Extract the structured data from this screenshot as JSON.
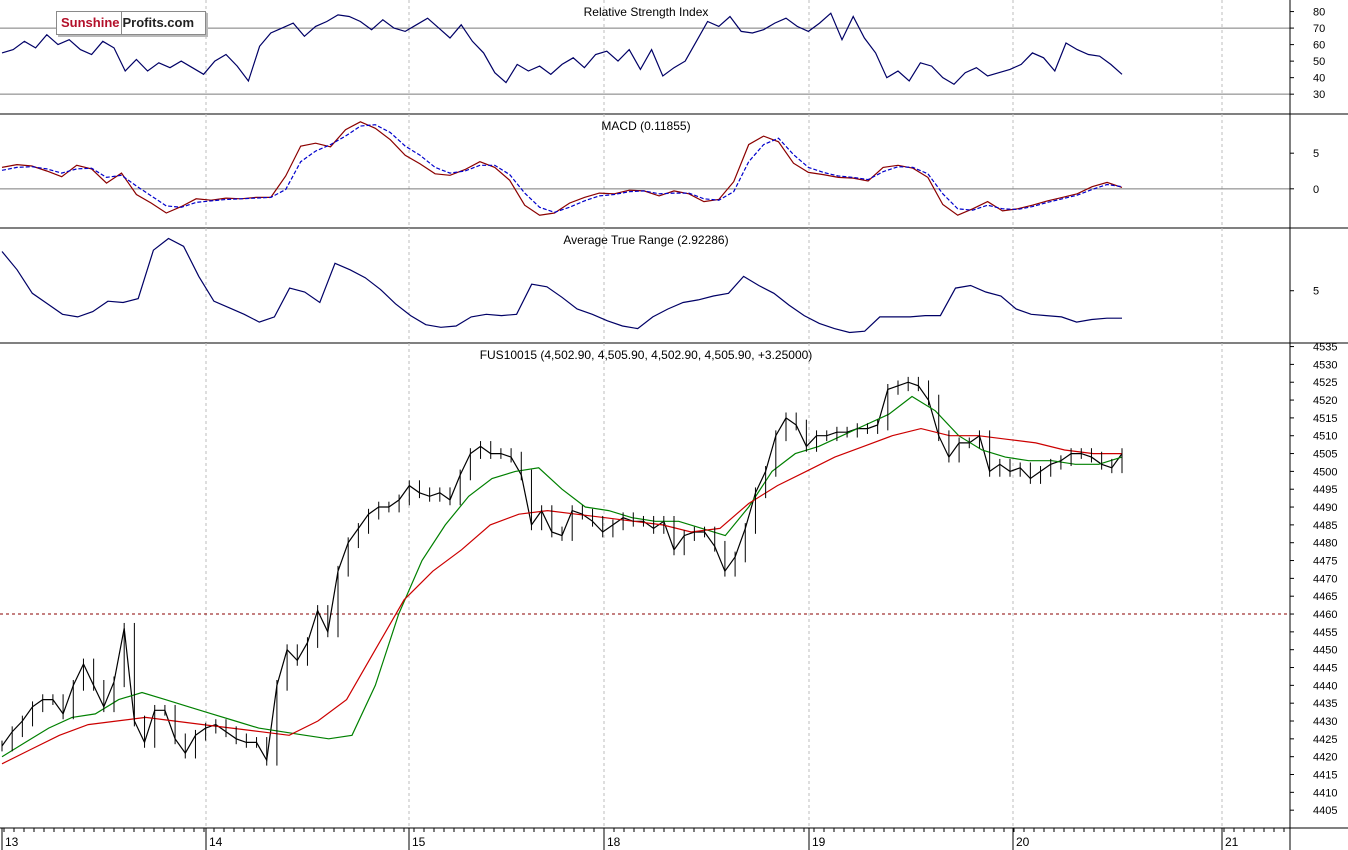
{
  "logo": {
    "part1": "Sunshine",
    "part2": "Profits.com"
  },
  "chart_data": [
    {
      "type": "line",
      "title": "Relative Strength Index",
      "yticks": [
        30,
        40,
        50,
        60,
        70,
        80
      ],
      "ylim": [
        18,
        87
      ],
      "reference_lines": [
        30,
        70
      ],
      "grid": true,
      "series": [
        {
          "values": [
            55,
            57,
            62,
            58,
            66,
            60,
            63,
            57,
            54,
            62,
            58,
            44,
            51,
            44,
            49,
            46,
            50,
            46,
            42,
            50,
            54,
            47,
            38,
            59,
            67,
            70,
            73,
            65,
            71,
            74,
            78,
            77,
            74,
            69,
            75,
            70,
            68,
            72,
            76,
            70,
            64,
            72,
            62,
            55,
            43,
            37,
            48,
            44,
            47,
            42,
            48,
            52,
            46,
            54,
            56,
            50,
            57,
            45,
            57,
            41,
            46,
            50,
            62,
            74,
            71,
            77,
            68,
            67,
            69,
            73,
            76,
            71,
            68,
            73,
            79,
            63,
            77,
            64,
            55,
            40,
            44,
            38,
            49,
            47,
            40,
            36,
            43,
            46,
            41,
            43,
            45,
            48,
            55,
            52,
            44,
            61,
            57,
            54,
            53,
            48,
            42
          ]
        }
      ]
    },
    {
      "type": "line",
      "title": "MACD (0.11855)",
      "yticks": [
        0,
        5
      ],
      "ylim": [
        -5.5,
        10.5
      ],
      "reference_lines": [
        0
      ],
      "grid": true,
      "series": [
        {
          "color": "#8b0000",
          "values": [
            3.0,
            3.4,
            3.2,
            2.5,
            1.7,
            3.3,
            2.8,
            0.8,
            2.2,
            -0.8,
            -2.0,
            -3.4,
            -2.5,
            -1.4,
            -1.6,
            -1.3,
            -1.4,
            -1.2,
            -1.2,
            1.8,
            6.0,
            6.4,
            5.9,
            8.3,
            9.4,
            8.5,
            6.9,
            4.7,
            3.5,
            2.1,
            1.9,
            2.7,
            3.8,
            3.0,
            1.2,
            -2.3,
            -3.7,
            -3.4,
            -2.0,
            -1.2,
            -0.6,
            -0.7,
            -0.2,
            -0.3,
            -1.0,
            -0.3,
            -0.7,
            -1.8,
            -1.5,
            1.0,
            6.2,
            7.4,
            6.6,
            3.6,
            2.3,
            2.0,
            1.6,
            1.5,
            1.1,
            3.0,
            3.3,
            2.9,
            1.6,
            -2.2,
            -3.7,
            -2.8,
            -1.8,
            -3.1,
            -2.8,
            -2.3,
            -1.7,
            -1.2,
            -0.7,
            0.3,
            0.9,
            0.2
          ]
        },
        {
          "color": "#0000cc",
          "dashed": true,
          "values": [
            2.6,
            3.0,
            3.1,
            2.8,
            2.2,
            2.8,
            2.9,
            1.6,
            1.9,
            0.4,
            -1.0,
            -2.4,
            -2.6,
            -1.9,
            -1.7,
            -1.5,
            -1.4,
            -1.3,
            -1.2,
            -0.1,
            3.8,
            5.3,
            6.2,
            7.4,
            8.8,
            9.0,
            7.9,
            6.0,
            4.7,
            3.0,
            2.2,
            2.5,
            3.3,
            3.3,
            2.0,
            -0.6,
            -2.6,
            -3.3,
            -2.6,
            -1.7,
            -1.0,
            -0.8,
            -0.4,
            -0.3,
            -0.7,
            -0.6,
            -0.6,
            -1.4,
            -1.6,
            -0.4,
            3.8,
            6.2,
            7.1,
            4.8,
            3.0,
            2.3,
            1.8,
            1.6,
            1.3,
            2.4,
            3.1,
            3.0,
            2.1,
            -0.7,
            -2.8,
            -3.0,
            -2.3,
            -2.8,
            -2.9,
            -2.5,
            -1.9,
            -1.4,
            -0.9,
            -0.1,
            0.6,
            0.3
          ]
        }
      ]
    },
    {
      "type": "line",
      "title": "Average True Range (2.92286)",
      "yticks": [
        5
      ],
      "ylim": [
        1.0,
        9.8
      ],
      "grid": true,
      "series": [
        {
          "values": [
            8.0,
            6.6,
            4.8,
            4.0,
            3.2,
            3.0,
            3.4,
            4.2,
            4.1,
            4.4,
            8.1,
            9.0,
            8.4,
            6.1,
            4.2,
            3.7,
            3.2,
            2.6,
            3.0,
            5.2,
            4.9,
            4.1,
            7.1,
            6.6,
            6.0,
            5.1,
            4.0,
            3.1,
            2.4,
            2.2,
            2.3,
            3.0,
            3.2,
            3.1,
            3.2,
            5.5,
            5.3,
            4.5,
            3.6,
            3.2,
            2.7,
            2.3,
            2.1,
            3.0,
            3.6,
            4.1,
            4.3,
            4.6,
            4.8,
            6.1,
            5.4,
            4.8,
            3.9,
            3.1,
            2.5,
            2.1,
            1.8,
            1.9,
            3.0,
            3.0,
            3.0,
            3.1,
            3.1,
            5.2,
            5.4,
            4.9,
            4.6,
            3.6,
            3.2,
            3.1,
            3.0,
            2.6,
            2.8,
            2.9,
            2.9
          ]
        }
      ]
    },
    {
      "type": "line",
      "title": "FUS10015 (4,502.90, 4,505.90, 4,502.90, 4,505.90, +3.25000)",
      "x_ticks": [
        "13",
        "14",
        "15",
        "18",
        "19",
        "20",
        "21"
      ],
      "yticks": [
        4405,
        4410,
        4415,
        4420,
        4425,
        4430,
        4435,
        4440,
        4445,
        4450,
        4455,
        4460,
        4465,
        4470,
        4475,
        4480,
        4485,
        4490,
        4495,
        4500,
        4505,
        4510,
        4515,
        4520,
        4525,
        4530,
        4535
      ],
      "ylim": [
        4400,
        4536
      ],
      "reference_lines": [
        {
          "value": 4460,
          "style": "dashed",
          "color": "#8b0000"
        }
      ],
      "grid": true,
      "series": [
        {
          "name": "price",
          "color": "#000000",
          "values": [
            4423,
            4427,
            4430,
            4434,
            4436,
            4436,
            4432,
            4440,
            4446,
            4440,
            4434,
            4441,
            4456,
            4430,
            4424,
            4433,
            4433,
            4425,
            4421,
            4426,
            4428,
            4429,
            4427,
            4425,
            4424,
            4424,
            4419,
            4440,
            4450,
            4447,
            4452,
            4461,
            4455,
            4472,
            4480,
            4484,
            4488,
            4490,
            4490,
            4492,
            4496,
            4494,
            4493,
            4494,
            4492,
            4499,
            4505,
            4507,
            4505,
            4505,
            4504,
            4499,
            4485,
            4489,
            4483,
            4482,
            4489,
            4488,
            4486,
            4483,
            4485,
            4487,
            4486,
            4486,
            4484,
            4486,
            4478,
            4482,
            4483,
            4483,
            4479,
            4472,
            4476,
            4484,
            4494,
            4500,
            4510,
            4515,
            4513,
            4507,
            4510,
            4510,
            4511,
            4511,
            4512,
            4512,
            4513,
            4523,
            4524,
            4525,
            4524,
            4520,
            4510,
            4504,
            4508,
            4508,
            4510,
            4500,
            4502,
            4500,
            4501,
            4498,
            4500,
            4502,
            4503,
            4505,
            4505,
            4504,
            4502,
            4501,
            4505
          ]
        },
        {
          "name": "average-green",
          "color": "#008000",
          "values": [
            4420,
            4424,
            4428,
            4431,
            4432,
            4436,
            4438,
            4436,
            4434,
            4432,
            4430,
            4428,
            4427,
            4426,
            4425,
            4426,
            4440,
            4460,
            4475,
            4485,
            4493,
            4498,
            4500,
            4501,
            4495,
            4490,
            4489,
            4487,
            4486,
            4486,
            4484,
            4482,
            4490,
            4500,
            4505,
            4507,
            4510,
            4513,
            4516,
            4521,
            4517,
            4510,
            4506,
            4504,
            4503,
            4503,
            4502,
            4502,
            4504
          ]
        },
        {
          "name": "average-red",
          "color": "#cc0000",
          "values": [
            4418,
            4422,
            4426,
            4429,
            4430,
            4431,
            4430,
            4429,
            4428,
            4427,
            4426,
            4430,
            4436,
            4450,
            4464,
            4472,
            4478,
            4485,
            4488,
            4489,
            4488,
            4487,
            4486,
            4485,
            4483,
            4484,
            4491,
            4496,
            4500,
            4504,
            4507,
            4510,
            4512,
            4510,
            4510,
            4509,
            4508,
            4506,
            4505,
            4505
          ]
        }
      ]
    }
  ]
}
